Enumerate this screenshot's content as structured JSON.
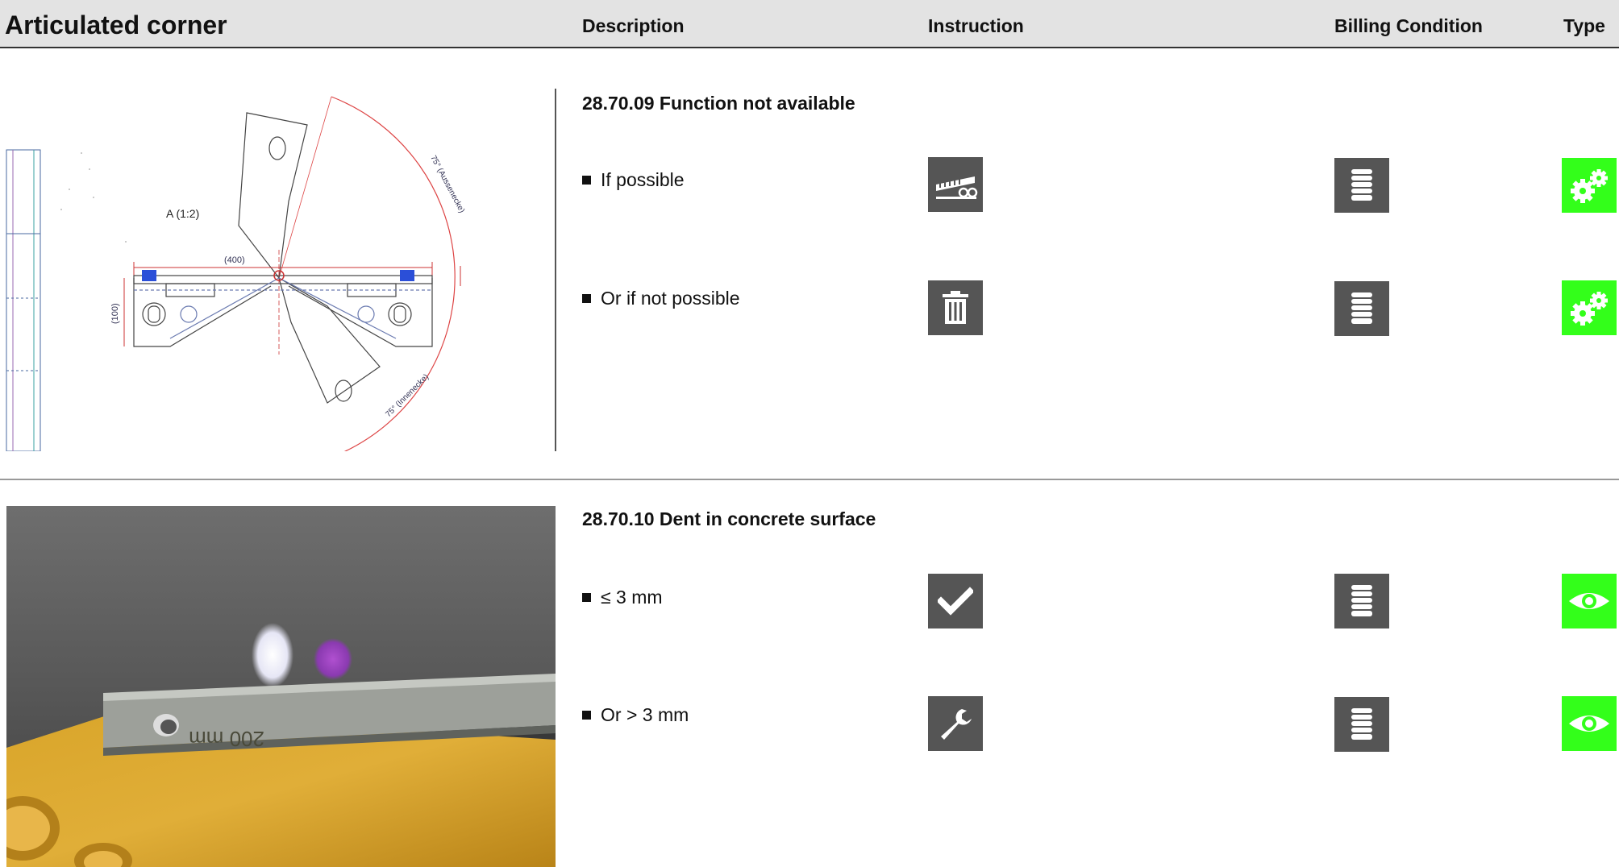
{
  "header": {
    "title": "Articulated corner",
    "columns": {
      "description": "Description",
      "instruction": "Instruction",
      "billing": "Billing Condition",
      "type": "Type"
    }
  },
  "sections": [
    {
      "title": "28.70.09 Function not available",
      "drawing": {
        "label": "A (1:2)",
        "dim_width": "(400)",
        "dim_height": "(100)",
        "angle_outer": "75° (Aussenecke)",
        "angle_inner": "75° (Innenecke)"
      },
      "items": [
        {
          "text": "If possible",
          "instruction_icon": "grinding-machine-icon",
          "billing_icon": "coin-stack-icon",
          "type_icon": "gears-icon"
        },
        {
          "text": "Or if not possible",
          "instruction_icon": "trash-icon",
          "billing_icon": "coin-stack-icon",
          "type_icon": "gears-icon"
        }
      ]
    },
    {
      "title": "28.70.10 Dent in concrete surface",
      "photo": {
        "ruler_text": "200 mm"
      },
      "items": [
        {
          "text": "≤ 3 mm",
          "instruction_icon": "checkmark-icon",
          "billing_icon": "coin-stack-icon",
          "type_icon": "eye-icon"
        },
        {
          "text": "Or > 3 mm",
          "instruction_icon": "wrench-icon",
          "billing_icon": "coin-stack-icon",
          "type_icon": "eye-icon"
        }
      ]
    }
  ],
  "colors": {
    "header_bg": "#e3e3e3",
    "icon_dark": "#555555",
    "type_green": "#33ff1a"
  }
}
